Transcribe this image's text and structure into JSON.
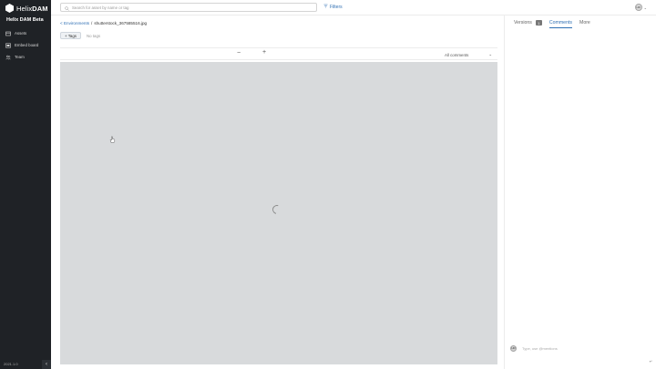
{
  "sidebar": {
    "logo_text_light": "Helix",
    "logo_text_bold": "DAM",
    "app_name": "Helix DAM Beta",
    "items": [
      {
        "label": "Assets",
        "icon": "assets-icon"
      },
      {
        "label": "Embed board",
        "icon": "embed-board-icon"
      },
      {
        "label": "Team",
        "icon": "team-icon"
      }
    ],
    "version": "2021.1.0",
    "collapse_icon": "chevron-left-icon"
  },
  "topbar": {
    "search_placeholder": "Search for asset by name or tag",
    "filters_label": "Filters",
    "user_initials": "HR"
  },
  "breadcrumb": {
    "back_link": "< Environments",
    "separator": "/",
    "file": "shutterstock_367585516.jpg"
  },
  "tags": {
    "button_label": "+ Tags",
    "empty_text": "No tags"
  },
  "viewer": {
    "zoom_out_label": "−",
    "zoom_in_label": "+",
    "comment_filter": "All comments",
    "comment_filter_icon": "chevron-down-icon",
    "state": "loading"
  },
  "panel": {
    "tabs": [
      {
        "label": "Versions",
        "badge": "1",
        "active": false
      },
      {
        "label": "Comments",
        "active": true
      },
      {
        "label": "More",
        "active": false
      }
    ],
    "comment_placeholder": "Type, use @mentions",
    "commenter_initials": "HR"
  },
  "colors": {
    "sidebar_bg": "#1f2226",
    "accent": "#2f6fb3",
    "canvas_bg": "#d6d8da"
  }
}
